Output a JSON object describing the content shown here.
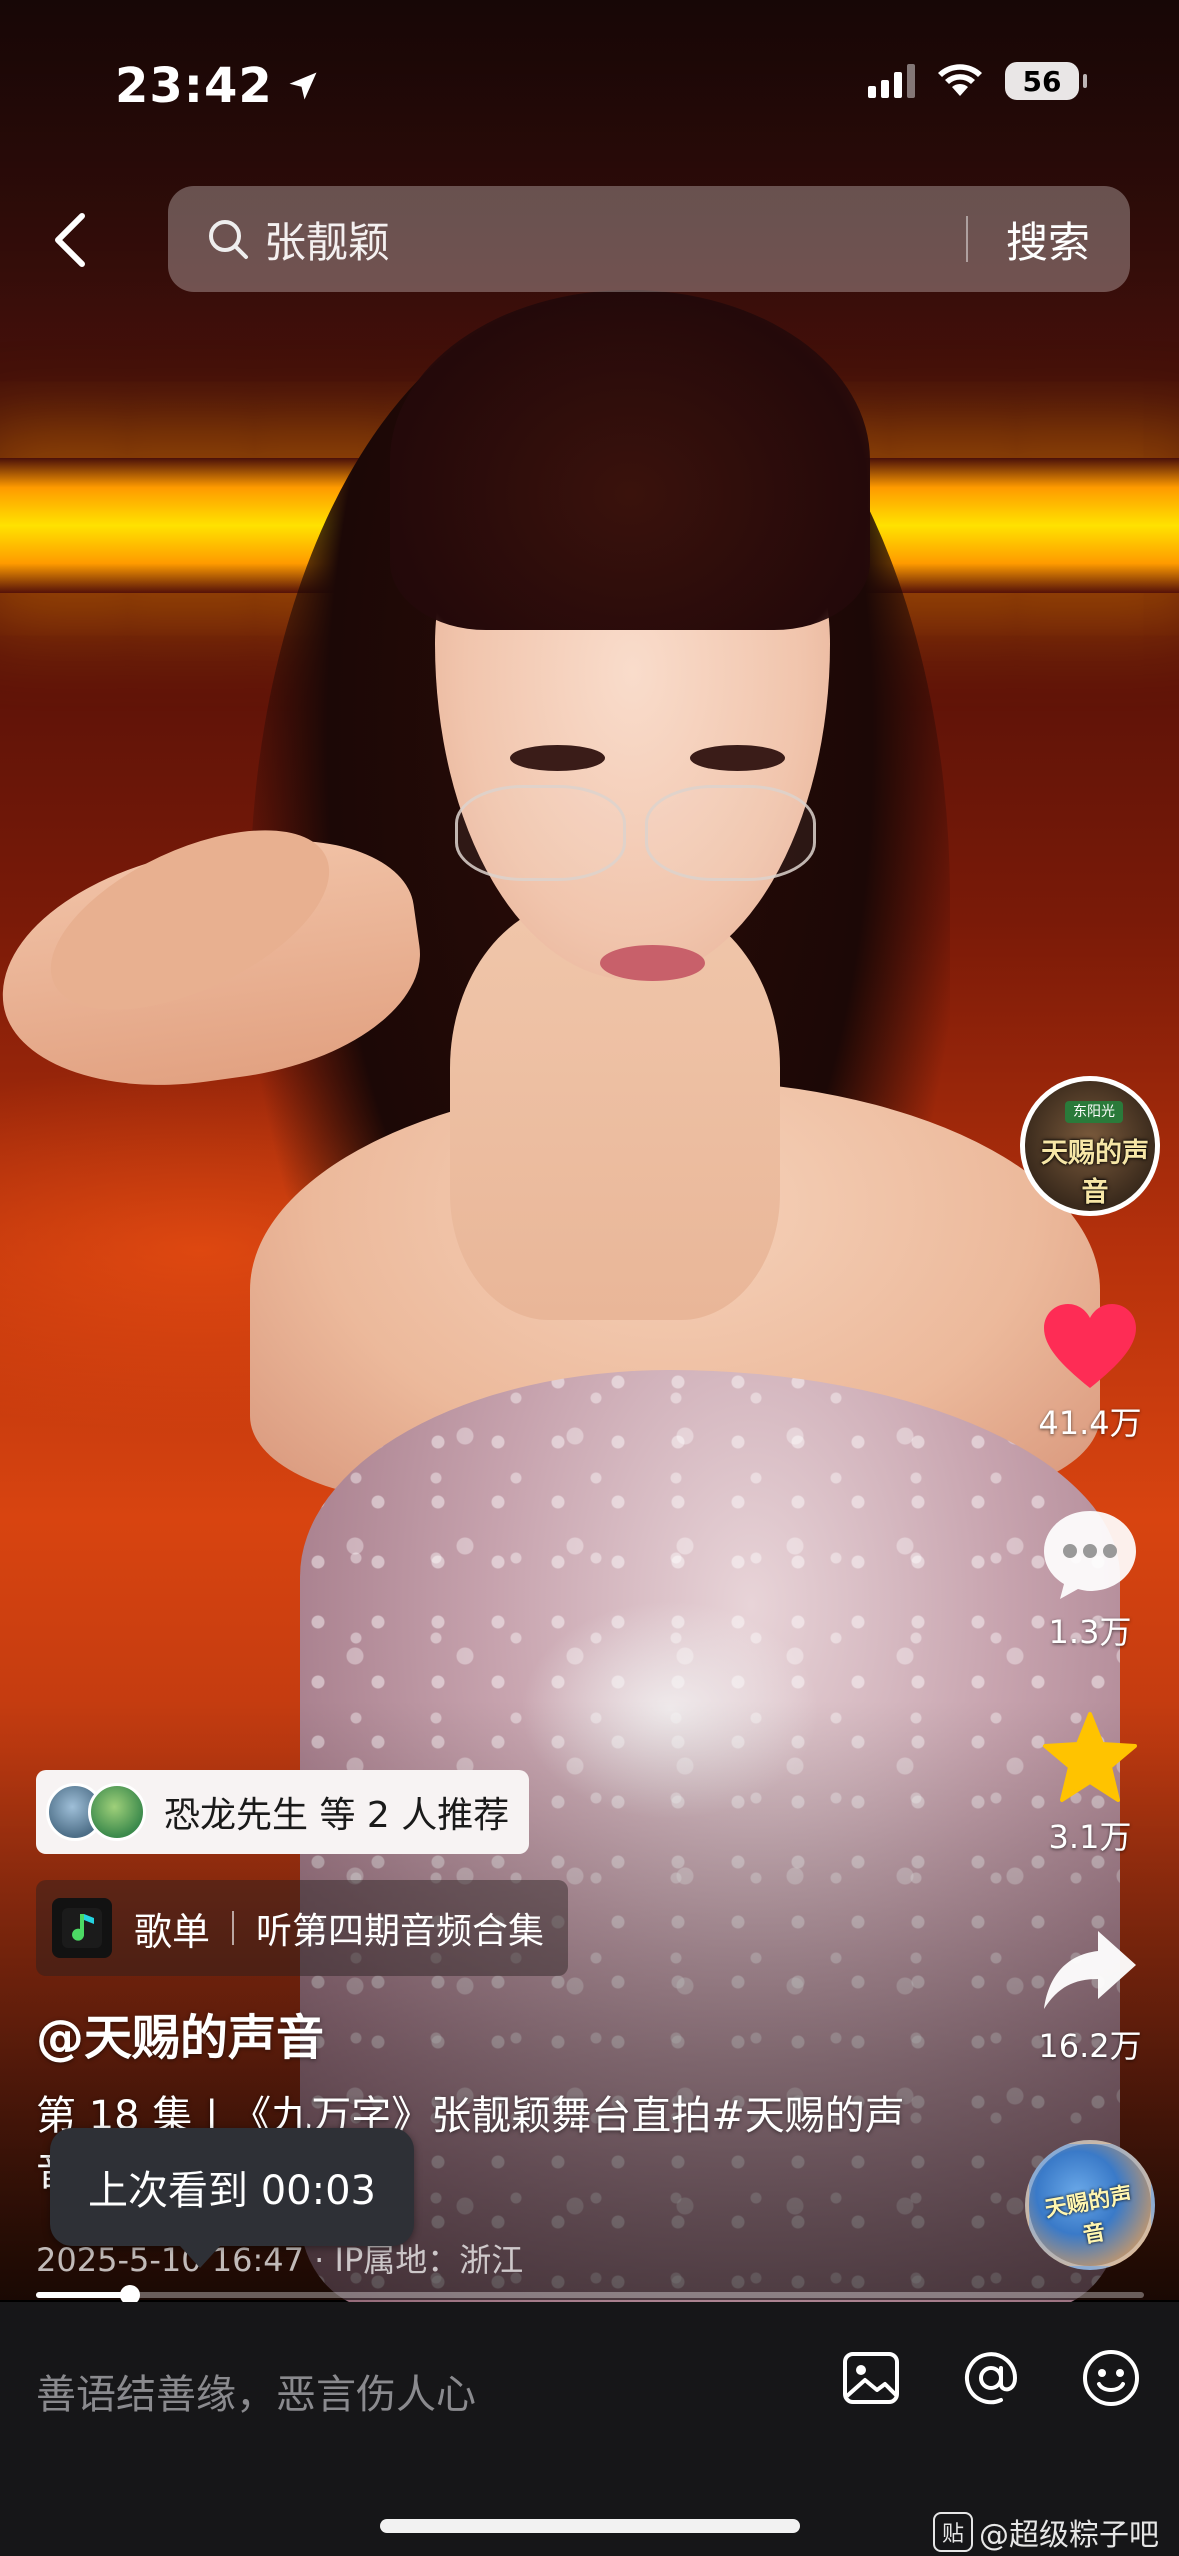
{
  "status_bar": {
    "time": "23:42",
    "battery": "56"
  },
  "search": {
    "query": "张靓颖",
    "submit_label": "搜索"
  },
  "rail": {
    "avatar_badge": "东阳光",
    "avatar_title": "天赐的声音",
    "likes": "41.4万",
    "comments": "1.3万",
    "favorites": "3.1万",
    "shares": "16.2万",
    "music_label": "天赐的声音",
    "like_color": "#fe2c55",
    "favorite_color": "#ffc300"
  },
  "video_info": {
    "recommend_text": "恐龙先生 等 2 人推荐",
    "playlist_label": "歌单",
    "playlist_title": "听第四期音频合集",
    "author": "@天赐的声音",
    "description": "第 18 集 | 《九万字》张靓颖舞台直拍#天赐的声音",
    "meta": "2025-5-10 16:47 · IP属地：浙江",
    "resume_tooltip": "上次看到 00:03",
    "progress_fraction": 0.085
  },
  "comment_bar": {
    "placeholder": "善语结善缘，恶言伤人心",
    "icons": [
      "image-icon",
      "mention-icon",
      "emoji-icon"
    ]
  },
  "watermark": {
    "badge": "贴",
    "text": "@超级粽子吧"
  }
}
